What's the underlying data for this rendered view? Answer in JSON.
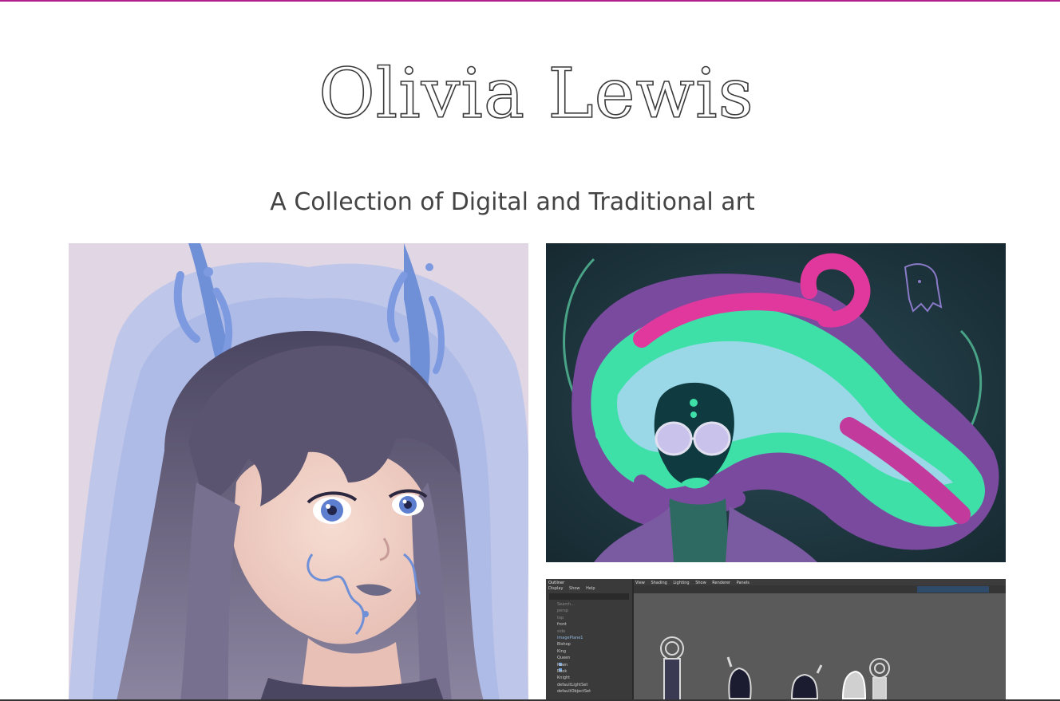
{
  "header": {
    "title": "Olivia Lewis",
    "tagline": "A Collection of Digital and Traditional art"
  },
  "colors": {
    "accent": "#b01e8e",
    "text": "#444444",
    "background": "#ffffff"
  },
  "gallery": {
    "items": [
      {
        "subject": "portrait of girl with dark hair and blue antler-like horns on lavender background"
      },
      {
        "subject": "character with flowing purple, pink and mint green hair and round glasses on dark teal background"
      },
      {
        "subject": "Maya 3D software screenshot with chess piece models in viewport"
      }
    ]
  },
  "maya": {
    "outliner_title": "Outliner",
    "outliner_menu": [
      "Display",
      "Show",
      "Help"
    ],
    "search_placeholder": "Search...",
    "outliner_items": [
      "persp",
      "top",
      "front",
      "side",
      "imagePlane1",
      "Bishop",
      "King",
      "Queen",
      "Pawn",
      "Rook",
      "Knight",
      "defaultLightSet",
      "defaultObjectSet"
    ],
    "viewport_menu": [
      "View",
      "Shading",
      "Lighting",
      "Show",
      "Renderer",
      "Panels"
    ]
  }
}
